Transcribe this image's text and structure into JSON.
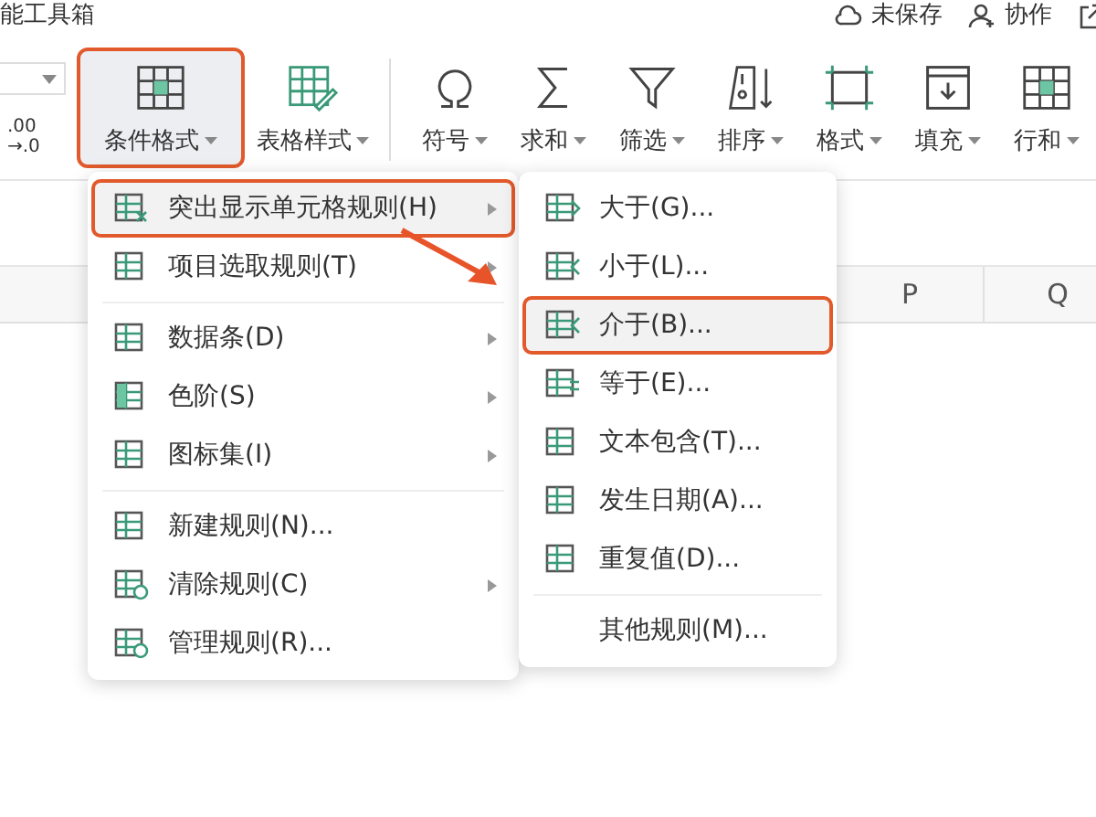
{
  "app_title": "能工具箱",
  "header_actions": [
    {
      "label": "未保存",
      "kind": "cloud"
    },
    {
      "label": "协作",
      "kind": "person"
    }
  ],
  "number_format": {
    "top": ".00",
    "bottom": "→.0"
  },
  "tools": [
    {
      "label": "条件格式",
      "kind": "cond",
      "highlighted": true
    },
    {
      "label": "表格样式",
      "kind": "style",
      "highlighted": false
    },
    {
      "label": "符号",
      "kind": "omega",
      "highlighted": false
    },
    {
      "label": "求和",
      "kind": "sigma",
      "highlighted": false
    },
    {
      "label": "筛选",
      "kind": "filter",
      "highlighted": false
    },
    {
      "label": "排序",
      "kind": "sort",
      "highlighted": false
    },
    {
      "label": "格式",
      "kind": "format",
      "highlighted": false
    },
    {
      "label": "填充",
      "kind": "fill",
      "highlighted": false
    },
    {
      "label": "行和",
      "kind": "rows",
      "highlighted": false
    }
  ],
  "columns": [
    "P",
    "Q"
  ],
  "menu": {
    "groups": [
      {
        "items": [
          {
            "label": "突出显示单元格规则(H)",
            "kind": "highlight",
            "submenu": true,
            "selected": true
          },
          {
            "label": "项目选取规则(T)",
            "kind": "top",
            "submenu": true,
            "selected": false
          }
        ]
      },
      {
        "items": [
          {
            "label": "数据条(D)",
            "kind": "bars",
            "submenu": true,
            "selected": false
          },
          {
            "label": "色阶(S)",
            "kind": "scale",
            "submenu": true,
            "selected": false
          },
          {
            "label": "图标集(I)",
            "kind": "list",
            "submenu": true,
            "selected": false
          }
        ]
      },
      {
        "items": [
          {
            "label": "新建规则(N)...",
            "kind": "new",
            "submenu": false,
            "selected": false
          },
          {
            "label": "清除规则(C)",
            "kind": "clear",
            "submenu": true,
            "selected": false
          },
          {
            "label": "管理规则(R)...",
            "kind": "manage",
            "submenu": false,
            "selected": false
          }
        ]
      }
    ]
  },
  "submenu": {
    "groups": [
      {
        "items": [
          {
            "label": "大于(G)...",
            "kind": "gt",
            "selected": false
          },
          {
            "label": "小于(L)...",
            "kind": "lt",
            "selected": false
          },
          {
            "label": "介于(B)...",
            "kind": "between",
            "selected": true
          },
          {
            "label": "等于(E)...",
            "kind": "eq",
            "selected": false
          },
          {
            "label": "文本包含(T)...",
            "kind": "text",
            "selected": false
          },
          {
            "label": "发生日期(A)...",
            "kind": "date",
            "selected": false
          },
          {
            "label": "重复值(D)...",
            "kind": "dup",
            "selected": false
          }
        ]
      },
      {
        "items": [
          {
            "label": "其他规则(M)...",
            "kind": "plain",
            "selected": false
          }
        ]
      }
    ]
  }
}
